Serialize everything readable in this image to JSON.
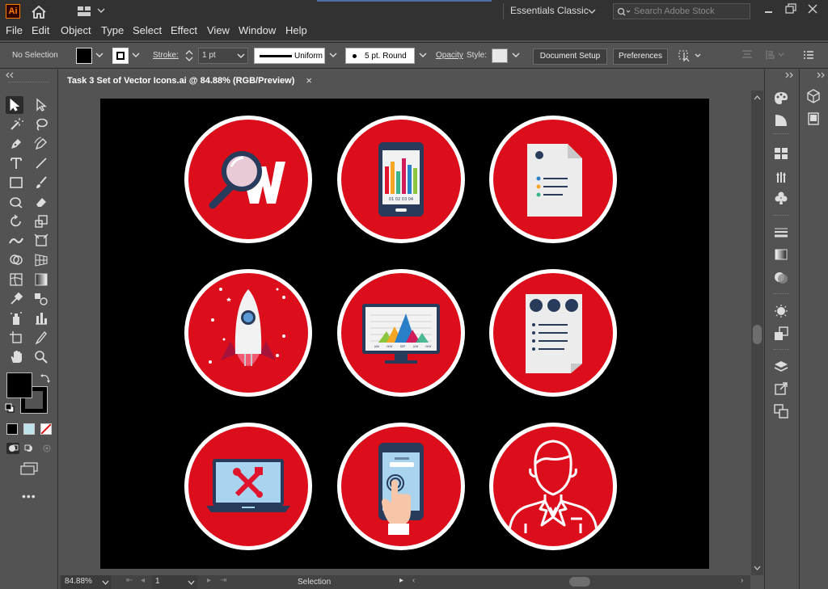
{
  "titlebar": {
    "app_logo": "Ai",
    "workspace": "Essentials Classic",
    "search_placeholder": "Search Adobe Stock"
  },
  "menu": [
    "File",
    "Edit",
    "Object",
    "Type",
    "Select",
    "Effect",
    "View",
    "Window",
    "Help"
  ],
  "control": {
    "selection_status": "No Selection",
    "stroke_label": "Stroke:",
    "stroke_weight": "1 pt",
    "profile_label": "Uniform",
    "brush_label": "5 pt. Round",
    "opacity_label": "Opacity",
    "style_label": "Style:",
    "document_setup": "Document Setup",
    "preferences": "Preferences"
  },
  "document_tab": {
    "title": "Task 3 Set of Vector Icons.ai @ 84.88% (RGB/Preview)",
    "close": "×"
  },
  "icons": {
    "brand_red": "#dc0e1c",
    "items": [
      "magnifier-w-icon",
      "phone-chart-icon",
      "document-icon",
      "rocket-icon",
      "monitor-chart-icon",
      "checklist-icon",
      "laptop-tools-icon",
      "phone-touch-icon",
      "businessman-icon"
    ],
    "chart_labels": {
      "phone_axis": "01 02 03 04",
      "monitor_axis": [
        "JAN",
        "MAY",
        "SEP",
        "JUN",
        "MAY"
      ]
    }
  },
  "status": {
    "zoom": "84.88%",
    "artboard_number": "1",
    "tool": "Selection"
  }
}
